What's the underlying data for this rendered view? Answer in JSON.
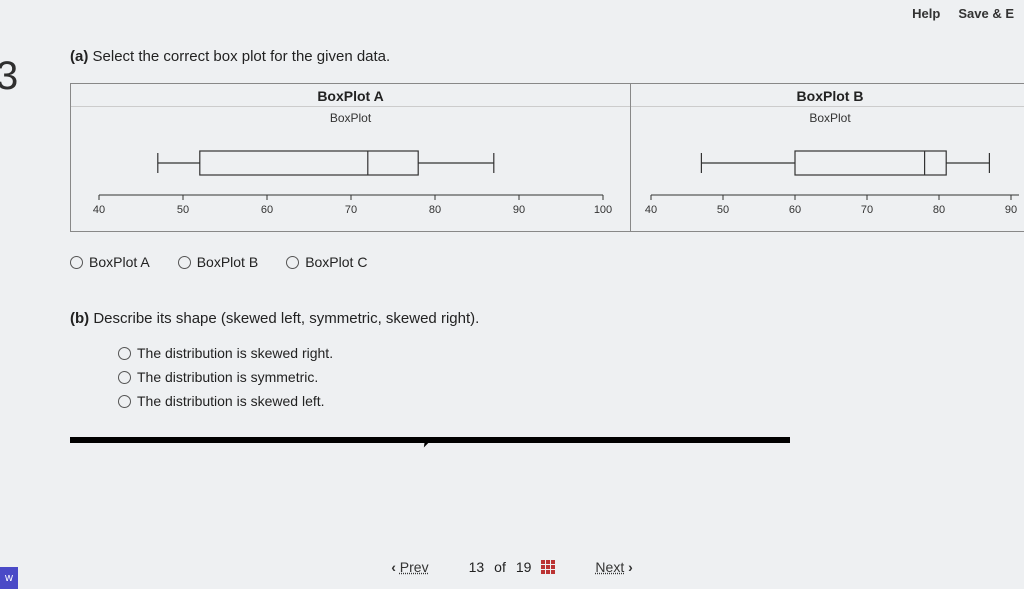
{
  "topbar": {
    "help": "Help",
    "save": "Save & E"
  },
  "question_number": "3",
  "part_a": {
    "label": "(a)",
    "text": "Select the correct box plot for the given data."
  },
  "plots": {
    "a": {
      "title": "BoxPlot A",
      "sub": "BoxPlot"
    },
    "b": {
      "title": "BoxPlot B",
      "sub": "BoxPlot"
    }
  },
  "chart_data": [
    {
      "type": "boxplot",
      "title": "BoxPlot A",
      "xlim": [
        40,
        100
      ],
      "ticks": [
        40,
        50,
        60,
        70,
        80,
        90,
        100
      ],
      "min": 47,
      "q1": 52,
      "median": 72,
      "q3": 78,
      "max": 87
    },
    {
      "type": "boxplot",
      "title": "BoxPlot B",
      "xlim": [
        40,
        90
      ],
      "ticks": [
        40,
        50,
        60,
        70,
        80,
        90
      ],
      "min": 47,
      "q1": 60,
      "median": 78,
      "q3": 81,
      "max": 87
    }
  ],
  "radio_a": {
    "opt1": "BoxPlot A",
    "opt2": "BoxPlot B",
    "opt3": "BoxPlot C"
  },
  "part_b": {
    "label": "(b)",
    "text": "Describe its shape (skewed left, symmetric, skewed right)."
  },
  "shape": {
    "opt1": "The distribution is skewed right.",
    "opt2": "The distribution is symmetric.",
    "opt3": "The distribution is skewed left."
  },
  "pager": {
    "prev": "Prev",
    "page": "13",
    "of": "of",
    "total": "19",
    "next": "Next"
  },
  "bottom_tag": "w"
}
